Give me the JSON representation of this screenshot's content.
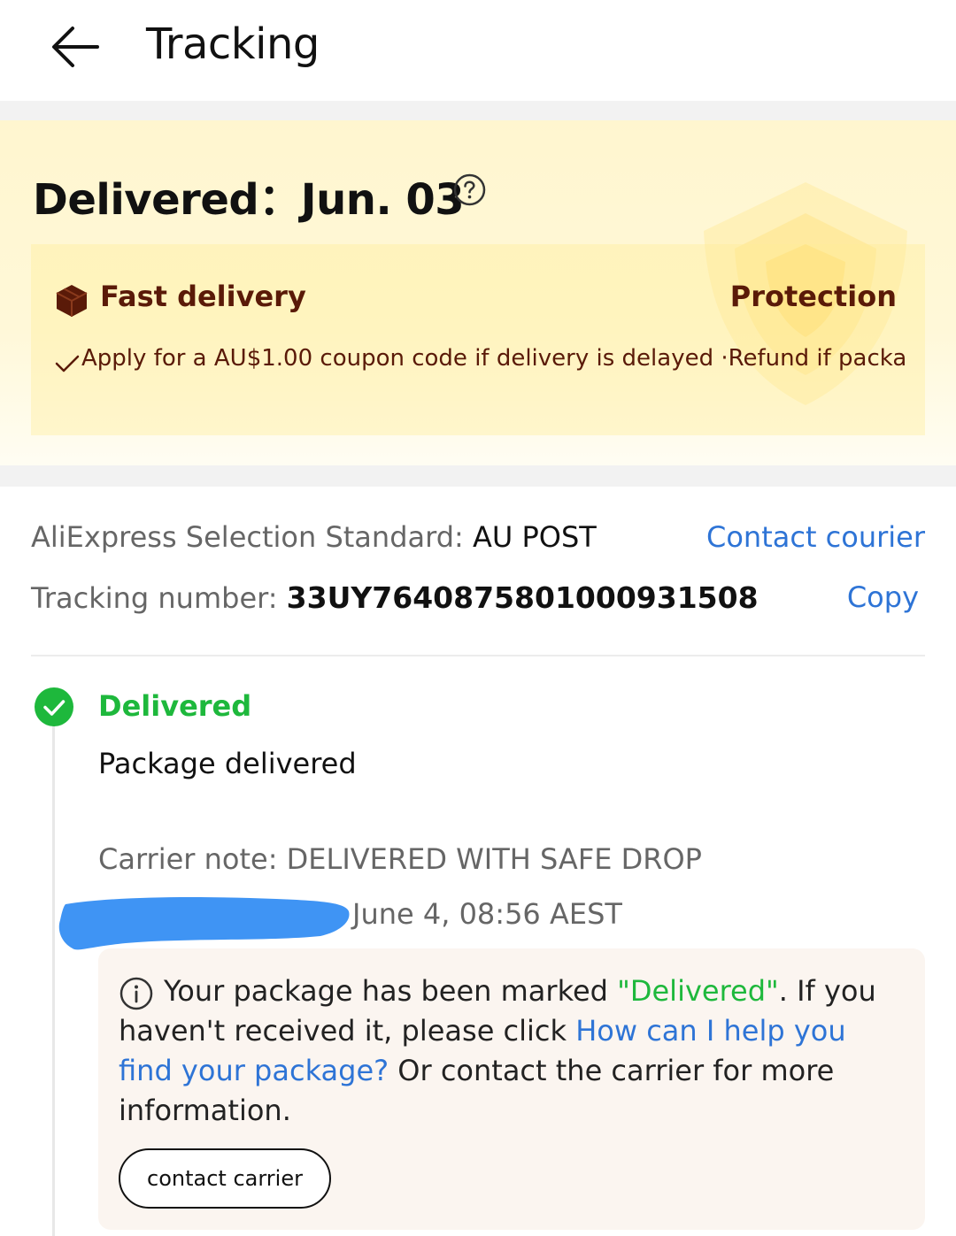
{
  "header": {
    "title": "Tracking",
    "back_icon": "arrow-left-icon"
  },
  "banner": {
    "status_prefix": "Delivered：",
    "date": "Jun. 03",
    "help_icon": "question-circle-icon",
    "fast_delivery_label": "Fast delivery",
    "protection_label": "Protection",
    "guarantee_text": "Apply for a AU$1.00 coupon code if delivery is delayed ·Refund if packa"
  },
  "courier": {
    "service_label": "AliExpress Selection Standard: ",
    "carrier": "AU POST",
    "contact_label": "Contact courier",
    "tracking_label": "Tracking number: ",
    "tracking_number": "33UY7640875801000931508",
    "copy_label": "Copy"
  },
  "timeline": {
    "status": "Delivered",
    "description": "Package delivered",
    "carrier_note": "Carrier note: DELIVERED WITH SAFE DROP",
    "time": "June 4, 08:56 AEST"
  },
  "notice": {
    "text_before": "Your package has been marked ",
    "status_quote": "\"Delivered\"",
    "text_middle": ". If you haven't received it, please click ",
    "help_link": "How can I help you find your package?",
    "text_after": " Or contact the carrier for more information.",
    "button_label": "contact carrier"
  },
  "colors": {
    "accent_blue": "#2e74d6",
    "success_green": "#1eb83c",
    "banner_brown": "#5a1a08"
  }
}
